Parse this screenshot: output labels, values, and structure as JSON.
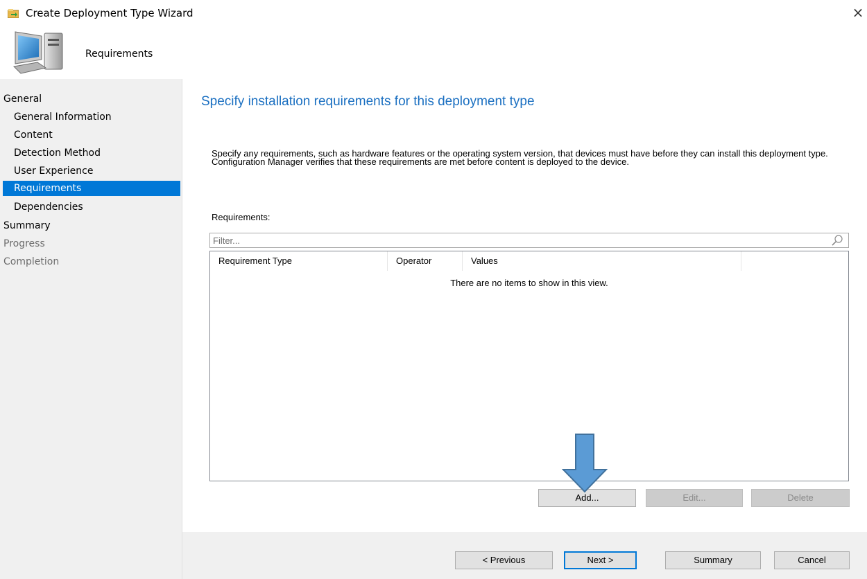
{
  "window": {
    "title": "Create Deployment Type Wizard",
    "close_glyph": "×"
  },
  "header": {
    "page_title": "Requirements"
  },
  "sidebar": {
    "items": [
      {
        "label": "General",
        "level": "top",
        "state": "normal"
      },
      {
        "label": "General Information",
        "level": "sub",
        "state": "normal"
      },
      {
        "label": "Content",
        "level": "sub",
        "state": "normal"
      },
      {
        "label": "Detection Method",
        "level": "sub",
        "state": "normal"
      },
      {
        "label": "User Experience",
        "level": "sub",
        "state": "normal"
      },
      {
        "label": "Requirements",
        "level": "sub",
        "state": "selected"
      },
      {
        "label": "Dependencies",
        "level": "sub",
        "state": "normal"
      },
      {
        "label": "Summary",
        "level": "top",
        "state": "normal"
      },
      {
        "label": "Progress",
        "level": "top",
        "state": "disabled"
      },
      {
        "label": "Completion",
        "level": "top",
        "state": "disabled"
      }
    ]
  },
  "main": {
    "title": "Specify installation requirements for this deployment type",
    "description": "Specify any requirements, such as hardware features or the operating system version, that devices must have before they can install this deployment type. Configuration Manager verifies that these requirements are met before content is deployed to the device.",
    "requirements_label": "Requirements:",
    "filter": {
      "placeholder": "Filter...",
      "value": ""
    },
    "columns": [
      "Requirement Type",
      "Operator",
      "Values"
    ],
    "empty_message": "There are no items to show in this view.",
    "buttons": {
      "add": "Add...",
      "edit": "Edit...",
      "delete": "Delete"
    }
  },
  "footer": {
    "previous": "< Previous",
    "next": "Next >",
    "summary": "Summary",
    "cancel": "Cancel"
  },
  "colors": {
    "accent": "#0078d7",
    "title_blue": "#1a6fc1",
    "sidebar_bg": "#f0f0f0",
    "arrow_fill": "#5b9bd5",
    "arrow_stroke": "#41719c"
  },
  "icons": {
    "title": "wizard-app-icon",
    "header": "computer-icon",
    "filter": "search-icon",
    "annotation": "down-arrow-annotation"
  }
}
